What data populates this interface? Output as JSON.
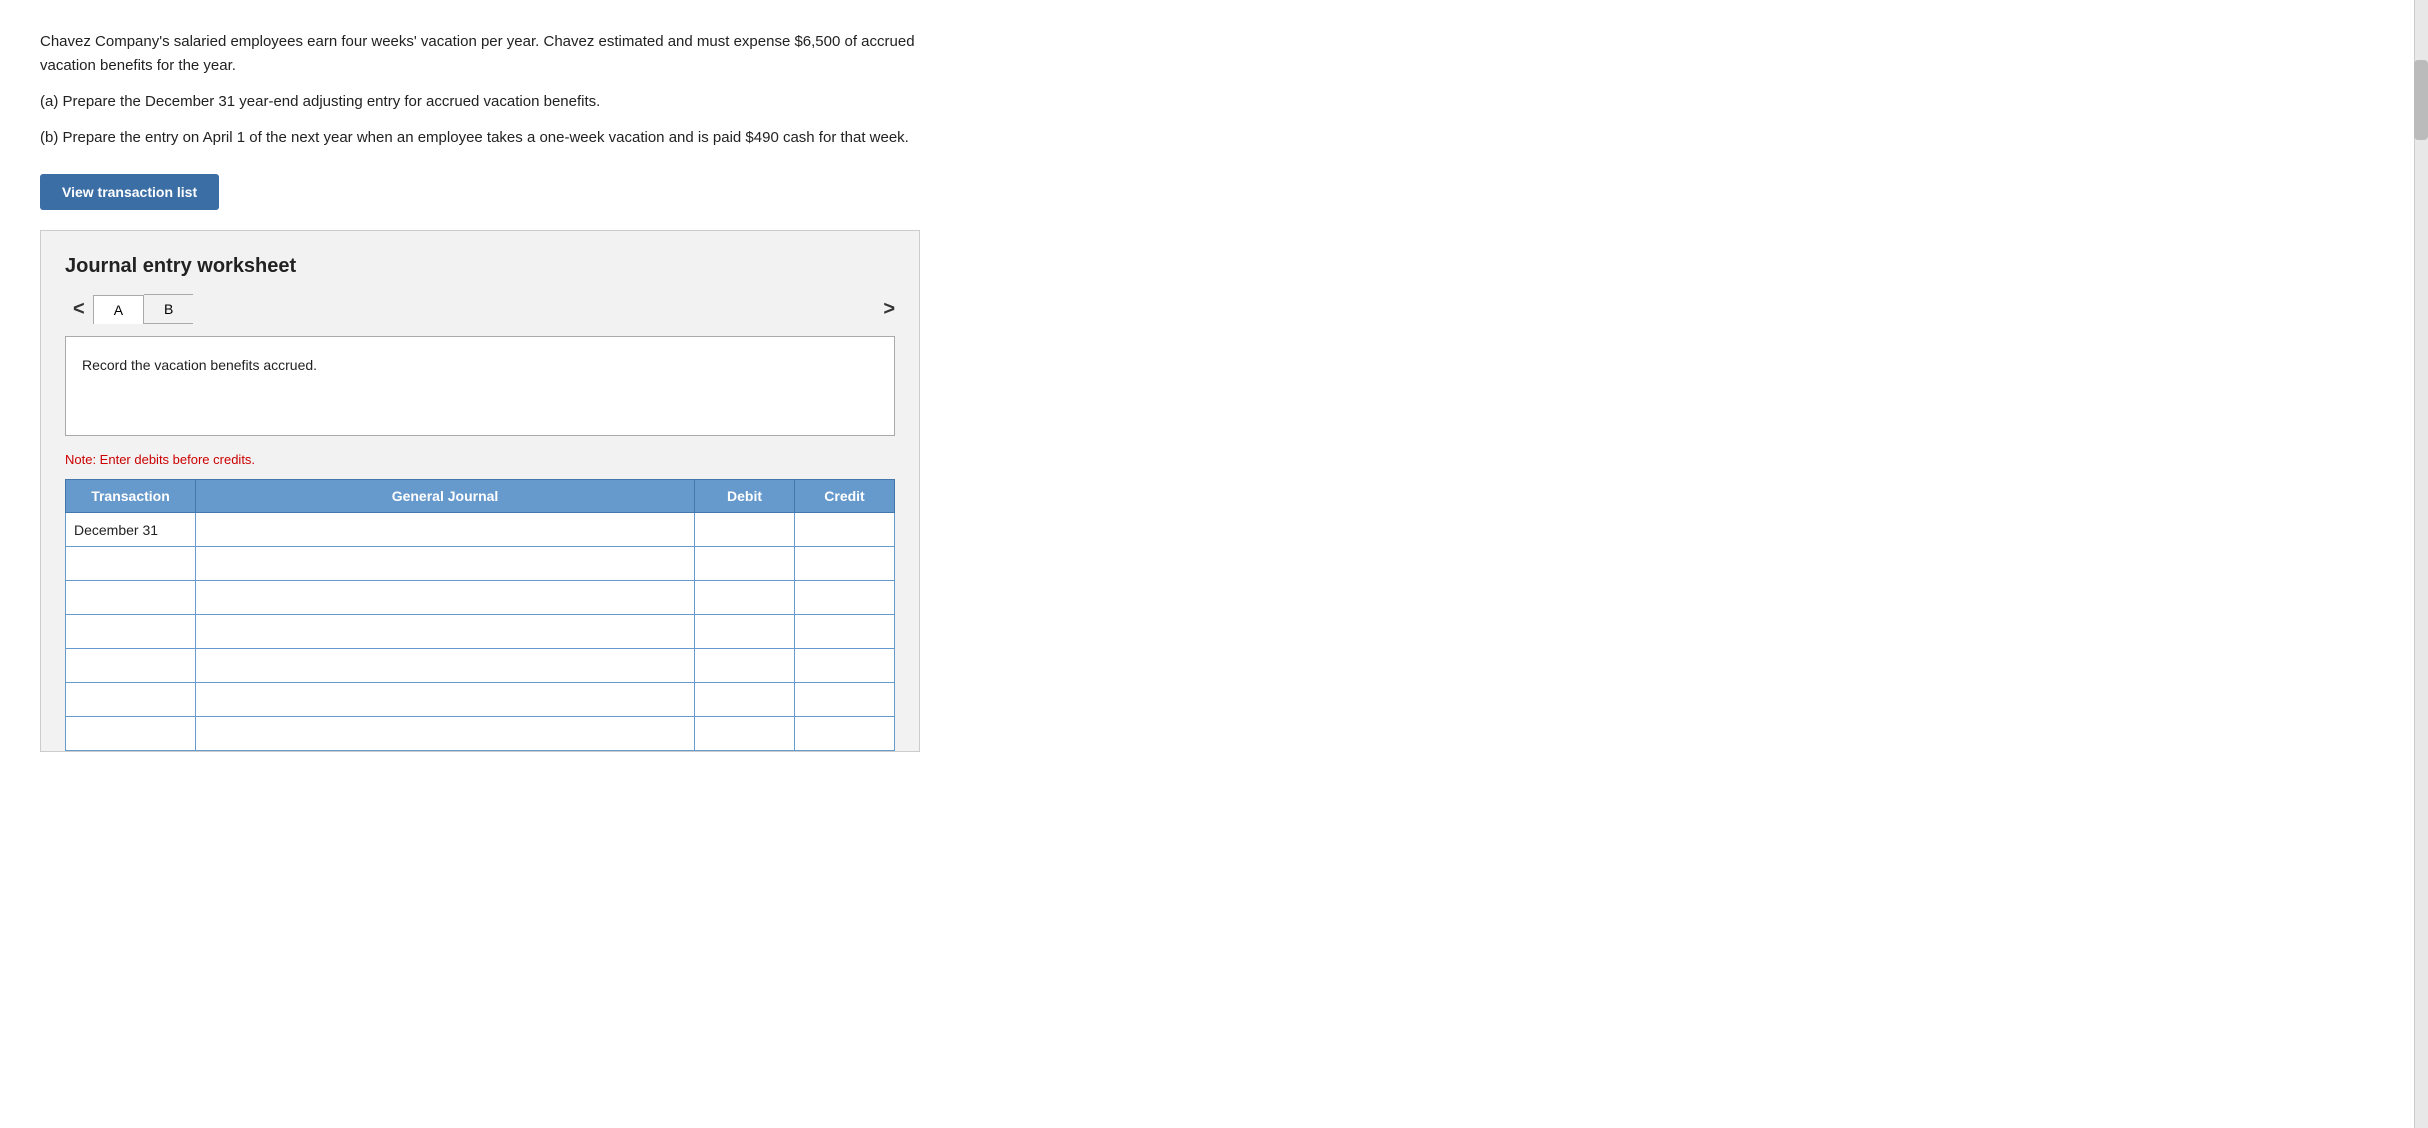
{
  "problem": {
    "paragraph1": "Chavez Company's salaried employees earn four weeks' vacation per year. Chavez estimated and must expense $6,500 of accrued vacation benefits for the year.",
    "paragraph2a": "(a) Prepare the December 31 year-end adjusting entry for accrued vacation benefits.",
    "paragraph2b": "(b) Prepare the entry on April 1 of the next year when an employee takes a one-week vacation and is paid $490 cash for that week."
  },
  "button": {
    "view_transactions": "View transaction list"
  },
  "worksheet": {
    "title": "Journal entry worksheet",
    "tab_a": "A",
    "tab_b": "B",
    "nav_prev": "<",
    "nav_next": ">",
    "instruction": "Record the vacation benefits accrued.",
    "note": "Note: Enter debits before credits.",
    "table": {
      "headers": [
        "Transaction",
        "General Journal",
        "Debit",
        "Credit"
      ],
      "rows": [
        {
          "transaction": "December 31",
          "journal": "",
          "debit": "",
          "credit": ""
        },
        {
          "transaction": "",
          "journal": "",
          "debit": "",
          "credit": ""
        },
        {
          "transaction": "",
          "journal": "",
          "debit": "",
          "credit": ""
        },
        {
          "transaction": "",
          "journal": "",
          "debit": "",
          "credit": ""
        },
        {
          "transaction": "",
          "journal": "",
          "debit": "",
          "credit": ""
        },
        {
          "transaction": "",
          "journal": "",
          "debit": "",
          "credit": ""
        },
        {
          "transaction": "",
          "journal": "",
          "debit": "",
          "credit": ""
        }
      ]
    }
  },
  "colors": {
    "btn_bg": "#3a6ea5",
    "tab_header_bg": "#6699cc",
    "note_color": "#cc0000"
  }
}
